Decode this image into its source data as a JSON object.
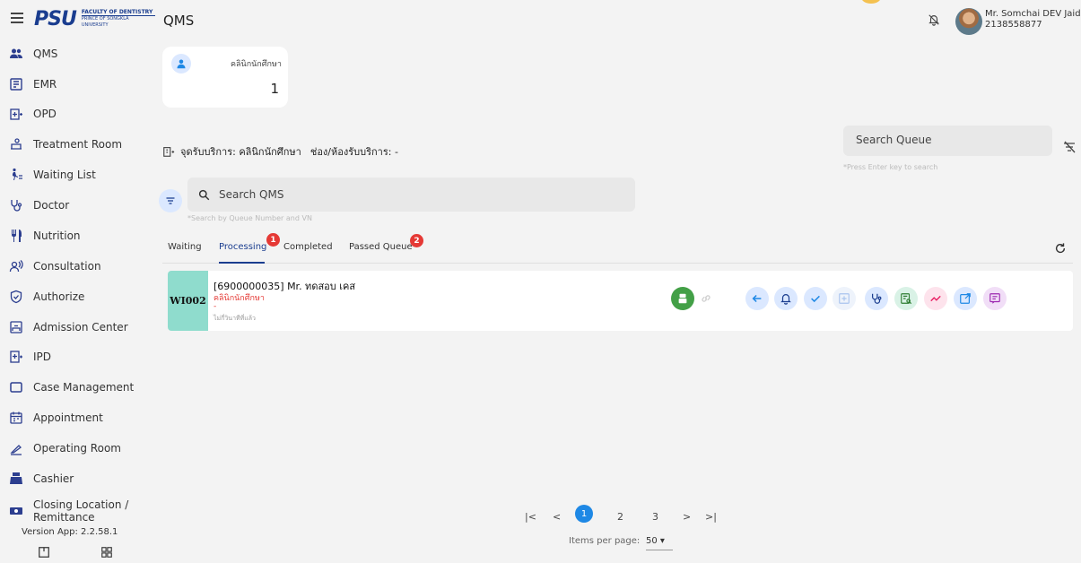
{
  "header": {
    "logo_mark": "PSU",
    "logo_line1": "FACULTY OF DENTISTRY",
    "logo_line2": "PRINCE OF SONGKLA UNIVERSITY",
    "app_title": "QMS",
    "user_name": "Mr. Somchai DEV Jaidee",
    "user_id": "2138558877"
  },
  "sidebar": {
    "items": [
      {
        "label": "QMS",
        "icon": "people-icon"
      },
      {
        "label": "EMR",
        "icon": "emr-icon"
      },
      {
        "label": "OPD",
        "icon": "opd-icon"
      },
      {
        "label": "Treatment Room",
        "icon": "treatment-icon"
      },
      {
        "label": "Waiting List",
        "icon": "walking-icon"
      },
      {
        "label": "Doctor",
        "icon": "stethoscope-icon"
      },
      {
        "label": "Nutrition",
        "icon": "cutlery-icon"
      },
      {
        "label": "Consultation",
        "icon": "consultation-icon"
      },
      {
        "label": "Authorize",
        "icon": "shield-check-icon"
      },
      {
        "label": "Admission Center",
        "icon": "admission-icon"
      },
      {
        "label": "IPD",
        "icon": "ipd-icon"
      },
      {
        "label": "Case Management",
        "icon": "case-icon"
      },
      {
        "label": "Appointment",
        "icon": "calendar-icon"
      },
      {
        "label": "Operating Room",
        "icon": "scalpel-icon"
      },
      {
        "label": "Cashier",
        "icon": "cashier-icon"
      },
      {
        "label": "Closing Location / Remittance",
        "icon": "money-icon"
      }
    ],
    "version": "Version App: 2.2.58.1"
  },
  "stat_card": {
    "label": "คลินิกนักศึกษา",
    "value": "1"
  },
  "service": {
    "location": "จุดรับบริการ: คลินิกนักศึกษา",
    "counter": "ช่อง/ห้องรับบริการ: -"
  },
  "search_queue": {
    "placeholder": "Search Queue",
    "hint": "*Press Enter key to search"
  },
  "search_qms": {
    "placeholder": "Search QMS",
    "hint": "*Search by Queue Number and VN"
  },
  "tabs": [
    {
      "label": "Waiting"
    },
    {
      "label": "Processing",
      "badge": "1"
    },
    {
      "label": "Completed"
    },
    {
      "label": "Passed Queue",
      "badge": "2"
    }
  ],
  "queue": [
    {
      "number": "WI002",
      "name": "[6900000035] Mr. ทดสอบ เคส",
      "clinic": "คลินิกนักศึกษา",
      "dash": "-",
      "time": "ไม่กี่วินาทีที่แล้ว"
    }
  ],
  "pagination": {
    "first": "|<",
    "prev": "<",
    "pages": [
      "1",
      "2",
      "3"
    ],
    "next": ">",
    "last": ">|",
    "items_label": "Items per page:",
    "items_value": "50 ▾"
  },
  "colors": {
    "brand": "#1a3d8f",
    "accent": "#1e88e5",
    "badge": "#e53935",
    "queue_tag": "#8fdccd"
  }
}
